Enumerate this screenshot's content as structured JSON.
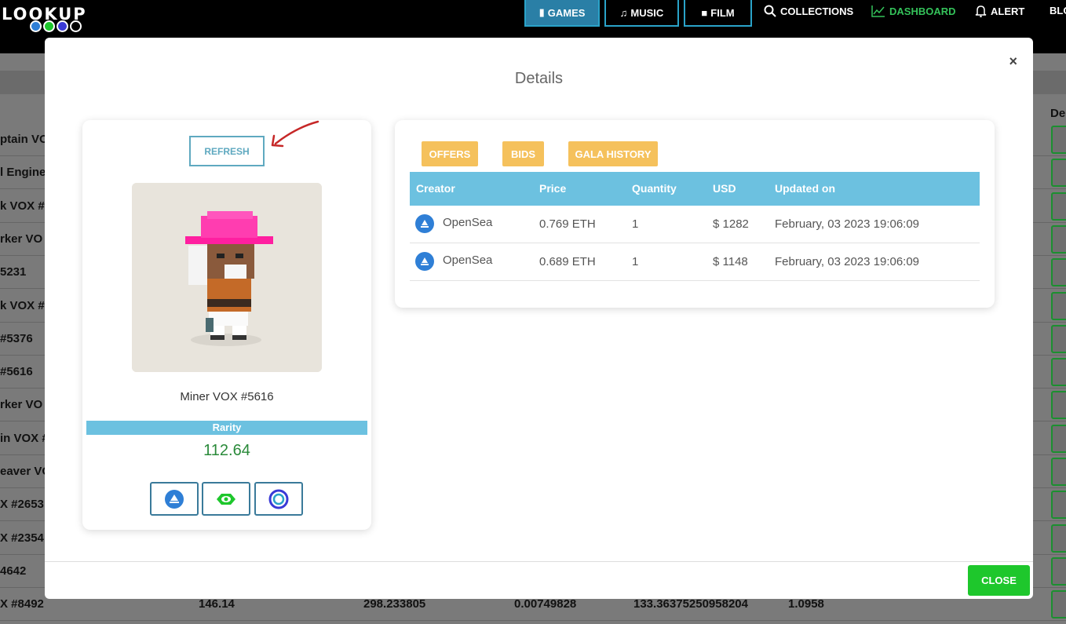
{
  "nav": {
    "logo": "LOOKUP",
    "games": "GAMES",
    "music": "MUSIC",
    "film": "FILM",
    "collections": "COLLECTIONS",
    "dashboard": "DASHBOARD",
    "alert": "ALERT",
    "blog": "BLO"
  },
  "background": {
    "column_header": "De",
    "rows": [
      {
        "name": "ptain VO"
      },
      {
        "name": "l Engine"
      },
      {
        "name": "k VOX #"
      },
      {
        "name": "rker VO"
      },
      {
        "name": "5231"
      },
      {
        "name": "k VOX #"
      },
      {
        "name": "#5376"
      },
      {
        "name": "#5616"
      },
      {
        "name": "rker VO"
      },
      {
        "name": "in VOX #"
      },
      {
        "name": "eaver VO"
      },
      {
        "name": "X #2653"
      },
      {
        "name": "X #2354"
      },
      {
        "name": "4642"
      },
      {
        "name": "X #8492",
        "c1": "146.14",
        "c2": "298.233805",
        "c3": "0.00749828",
        "c4": "133.36375250958204",
        "c5": "1.0958"
      }
    ]
  },
  "modal": {
    "title": "Details",
    "close_x": "×",
    "close_button": "CLOSE"
  },
  "item": {
    "refresh_label": "REFRESH",
    "name": "Miner VOX #5616",
    "rarity_label": "Rarity",
    "rarity_value": "112.64",
    "markets": [
      "opensea-icon",
      "looksrare-icon",
      "x2y2-icon"
    ]
  },
  "tabs": [
    "OFFERS",
    "BIDS",
    "GALA HISTORY"
  ],
  "offers": {
    "columns": [
      "Creator",
      "Price",
      "Quantity",
      "USD",
      "Updated on"
    ],
    "rows": [
      {
        "creator": "OpenSea",
        "price": "0.769 ETH",
        "quantity": "1",
        "usd": "$ 1282",
        "updated": "February, 03 2023 19:06:09"
      },
      {
        "creator": "OpenSea",
        "price": "0.689 ETH",
        "quantity": "1",
        "usd": "$ 1148",
        "updated": "February, 03 2023 19:06:09"
      }
    ]
  },
  "colors": {
    "accent_blue": "#6cc1e0",
    "tab_yellow": "#f5c15c",
    "close_green": "#1ec72c",
    "rarity_green": "#2a8a3a"
  }
}
